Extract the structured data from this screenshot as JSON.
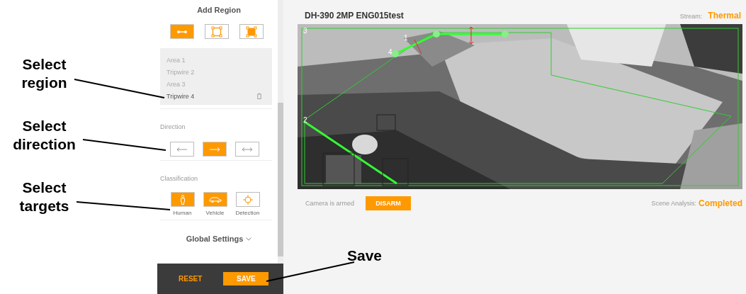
{
  "callouts": [
    {
      "label": "Select region"
    },
    {
      "label": "Select direction"
    },
    {
      "label": "Select targets"
    },
    {
      "label": "Save"
    }
  ],
  "sidebar": {
    "add_region": {
      "title": "Add Region",
      "buttons": [
        {
          "kind": "tripwire",
          "selected": true
        },
        {
          "kind": "area",
          "selected": false
        },
        {
          "kind": "filled-area",
          "selected": false
        }
      ]
    },
    "regions": [
      {
        "label": "Area 1",
        "selected": false
      },
      {
        "label": "Tripwire 2",
        "selected": false
      },
      {
        "label": "Area 3",
        "selected": false
      },
      {
        "label": "Tripwire 4",
        "selected": true
      }
    ],
    "direction": {
      "title": "Direction",
      "buttons": [
        {
          "kind": "left",
          "selected": false
        },
        {
          "kind": "right",
          "selected": true
        },
        {
          "kind": "both",
          "selected": false
        }
      ]
    },
    "classification": {
      "title": "Classification",
      "buttons": [
        {
          "kind": "human",
          "label": "Human",
          "selected": true
        },
        {
          "kind": "vehicle",
          "label": "Vehicle",
          "selected": true
        },
        {
          "kind": "detection",
          "label": "Detection",
          "selected": false
        }
      ]
    },
    "global_settings": "Global Settings",
    "reset": "RESET",
    "save": "SAVE"
  },
  "camera": {
    "title": "DH-390 2MP ENG015test",
    "stream_label": "Stream:",
    "stream": "Thermal",
    "overlay_labels": [
      "3",
      "1",
      "4",
      "2"
    ],
    "armed_text": "Camera is armed",
    "disarm": "DISARM",
    "analysis_label": "Scene Analysis:",
    "analysis": "Completed"
  }
}
